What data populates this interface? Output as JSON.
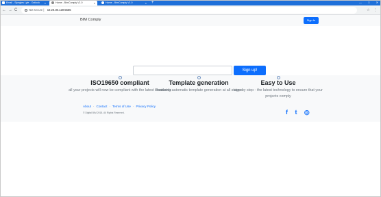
{
  "browser": {
    "tabs": [
      {
        "title": "Email - Sjongles Lyle - Outlook",
        "close": "×"
      },
      {
        "title": "Home - BimComply V1.0",
        "close": "×"
      },
      {
        "title": "Home - BimComply V1.0",
        "close": "×"
      }
    ],
    "new_tab": "+",
    "window_controls": [
      "—",
      "□",
      "✕"
    ],
    "nav": {
      "back": "←",
      "forward": "→",
      "reload": "C"
    },
    "security_label": "Not secure",
    "url": "10.20.30.120:5555",
    "address_icons": [
      "☆",
      "⋮"
    ]
  },
  "site": {
    "brand": "BIM Comply",
    "signin_label": "Sign In"
  },
  "hero": {
    "input_placeholder": "",
    "signup_label": "Sign up!"
  },
  "features": [
    {
      "icon": "monitor-icon",
      "title": "ISO19650 compliant",
      "text": "all your projects will now be compliant with the latest standards"
    },
    {
      "icon": "layers-icon",
      "title": "Template generation",
      "text": "Featuring automatic template generation at all stages"
    },
    {
      "icon": "check-icon",
      "title": "Easy to Use",
      "text": "step by step - the latest technology to ensure that your projects comply"
    }
  ],
  "footer": {
    "links": [
      "About",
      "Contact",
      "Terms of  Use",
      "Privacy Policy"
    ],
    "separator": "·",
    "copyright": "© Digital BIM 2018. All Rights Reserved.",
    "social": [
      {
        "icon": "facebook-icon",
        "glyph": "f"
      },
      {
        "icon": "twitter-icon",
        "glyph": "t"
      },
      {
        "icon": "instagram-icon",
        "glyph": "◎"
      }
    ]
  },
  "colors": {
    "primary": "#0d6efd",
    "tab_strip": "#1e6fd9"
  }
}
